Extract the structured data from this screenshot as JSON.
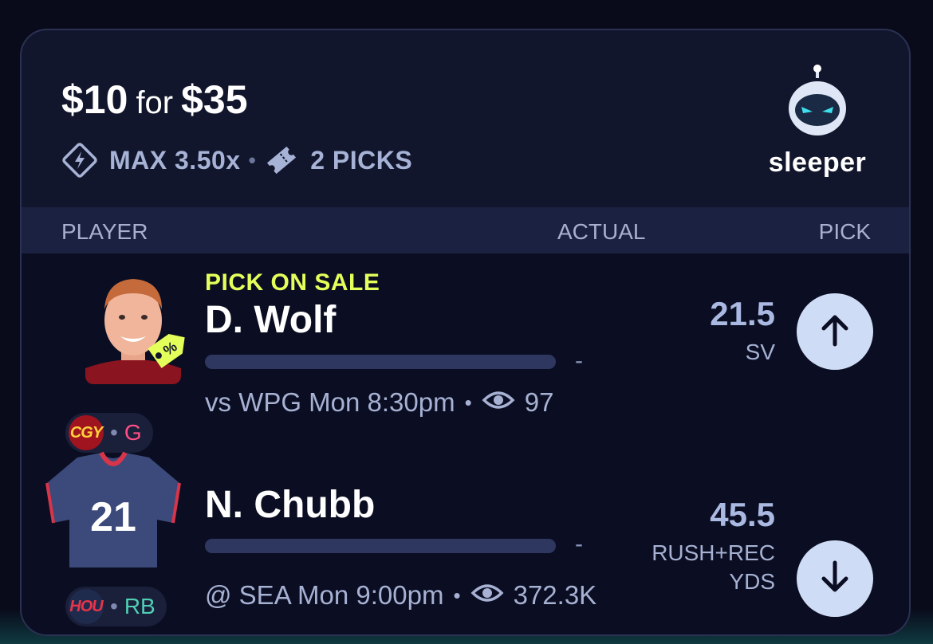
{
  "promo": {
    "stake": "$10",
    "for": "for",
    "payout": "$35"
  },
  "meta": {
    "max": "MAX 3.50x",
    "sep": "•",
    "picks": "2 PICKS"
  },
  "brand": {
    "name": "sleeper"
  },
  "columns": {
    "player": "PLAYER",
    "actual": "ACTUAL",
    "pick": "PICK"
  },
  "players": [
    {
      "badge": "PICK ON SALE",
      "name": "D. Wolf",
      "actual": "-",
      "team": "CGY",
      "position": "G",
      "dot": "•",
      "matchup": "vs WPG Mon 8:30pm",
      "views": "97",
      "line": "21.5",
      "stat": "SV",
      "pick_direction": "up",
      "icons": [
        "player-headshot",
        "sale-tag-icon",
        "eye-icon",
        "arrow-up-icon"
      ],
      "colors": {
        "team": "#a01420",
        "position": "#ff4f86"
      }
    },
    {
      "name": "N. Chubb",
      "jersey": "21",
      "actual": "-",
      "team": "HOU",
      "position": "RB",
      "dot": "•",
      "matchup": "@ SEA Mon 9:00pm",
      "views": "372.3K",
      "line": "45.5",
      "stat_line1": "RUSH+REC",
      "stat_line2": "YDS",
      "pick_direction": "down",
      "icons": [
        "jersey-icon",
        "eye-icon",
        "arrow-down-icon"
      ],
      "colors": {
        "team": "#1f2b4d",
        "position": "#4fd0b4"
      }
    }
  ],
  "colors": {
    "accent_sale": "#e4ff5a",
    "background": "#090b1b",
    "card": "#12162c",
    "pick_button": "#cfdcf5"
  }
}
